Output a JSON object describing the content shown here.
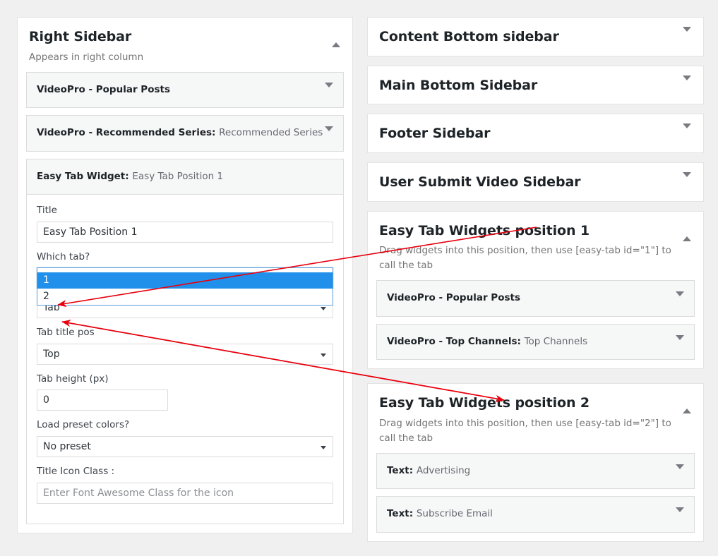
{
  "colors": {
    "page_background": "#f0f0f1",
    "panel_background": "#ffffff",
    "widget_background": "#f6f7f7",
    "dropdown_highlight": "#2090ea",
    "focus_border": "#5b9dd9",
    "annotation_arrow": "#e8000d",
    "title_text": "#1d2327",
    "muted_text": "#757575"
  },
  "left_column": {
    "panel": {
      "title": "Right Sidebar",
      "description": "Appears in right column",
      "toggle_icon": "triangle-up-icon",
      "widgets": [
        {
          "title": "VideoPro - Popular Posts",
          "subtitle": "",
          "toggle_icon": "triangle-down-icon",
          "expanded": false
        },
        {
          "title": "VideoPro - Recommended Series:",
          "subtitle": "Recommended Series",
          "toggle_icon": "triangle-down-icon",
          "expanded": false
        },
        {
          "title": "Easy Tab Widget:",
          "subtitle": "Easy Tab Position 1",
          "toggle_icon": "triangle-up-icon",
          "expanded": true
        }
      ],
      "form": {
        "title_field": {
          "label": "Title",
          "value": "Easy Tab Position 1"
        },
        "which_tab_field": {
          "label": "Which tab?",
          "value": "1",
          "open": true,
          "options": [
            "1",
            "2"
          ],
          "selected_option": "1"
        },
        "tab_style_field": {
          "label": "",
          "value": "Tab"
        },
        "tab_title_pos_field": {
          "label": "Tab title pos",
          "value": "Top"
        },
        "tab_height_field": {
          "label": "Tab height (px)",
          "value": "0"
        },
        "load_preset_colors_field": {
          "label": "Load preset colors?",
          "value": "No preset"
        },
        "title_icon_class_field": {
          "label": "Title Icon Class :",
          "value": "",
          "placeholder": "Enter Font Awesome Class for the icon"
        }
      }
    }
  },
  "right_column": {
    "panels": [
      {
        "title": "Content Bottom sidebar",
        "description": "",
        "toggle_icon": "triangle-down-icon",
        "expanded": false,
        "widgets": []
      },
      {
        "title": "Main Bottom Sidebar",
        "description": "",
        "toggle_icon": "triangle-down-icon",
        "expanded": false,
        "widgets": []
      },
      {
        "title": "Footer Sidebar",
        "description": "",
        "toggle_icon": "triangle-down-icon",
        "expanded": false,
        "widgets": []
      },
      {
        "title": "User Submit Video Sidebar",
        "description": "",
        "toggle_icon": "triangle-down-icon",
        "expanded": false,
        "widgets": []
      },
      {
        "title": "Easy Tab Widgets position 1",
        "description": "Drag widgets into this position, then use [easy-tab id=\"1\"] to call the tab",
        "toggle_icon": "triangle-up-icon",
        "expanded": true,
        "widgets": [
          {
            "title": "VideoPro - Popular Posts",
            "subtitle": "",
            "toggle_icon": "triangle-down-icon"
          },
          {
            "title": "VideoPro - Top Channels:",
            "subtitle": "Top Channels",
            "toggle_icon": "triangle-down-icon"
          }
        ]
      },
      {
        "title": "Easy Tab Widgets position 2",
        "description": "Drag widgets into this position, then use [easy-tab id=\"2\"] to call the tab",
        "toggle_icon": "triangle-up-icon",
        "expanded": true,
        "widgets": [
          {
            "title": "Text:",
            "subtitle": "Advertising",
            "toggle_icon": "triangle-down-icon"
          },
          {
            "title": "Text:",
            "subtitle": "Subscribe Email",
            "toggle_icon": "triangle-down-icon"
          }
        ]
      }
    ]
  },
  "annotations": {
    "arrow_one": {
      "from_label": "Easy Tab Widgets position 1",
      "to_label": "dropdown option 1"
    },
    "arrow_two": {
      "from_label": "dropdown option 2",
      "to_label": "Easy Tab Widgets position 2"
    }
  }
}
